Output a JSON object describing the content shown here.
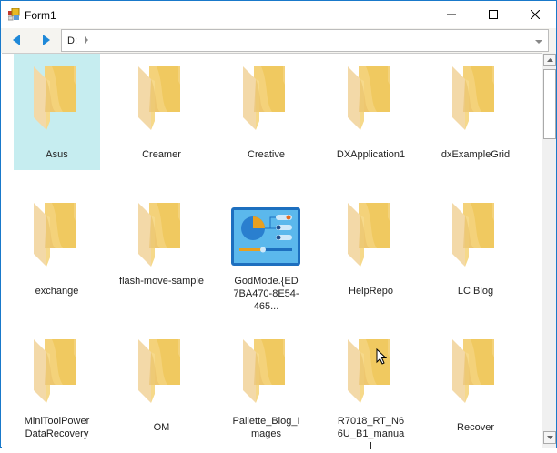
{
  "window": {
    "title": "Form1",
    "minimize": "—",
    "maximize": "☐",
    "close": "✕"
  },
  "toolbar": {
    "back": "back",
    "forward": "forward",
    "drive": "D:"
  },
  "items": [
    {
      "label": "Asus",
      "type": "folder",
      "selected": true
    },
    {
      "label": "Creamer",
      "type": "folder"
    },
    {
      "label": "Creative",
      "type": "folder"
    },
    {
      "label": "DXApplication1",
      "type": "folder"
    },
    {
      "label": "dxExampleGrid",
      "type": "folder"
    },
    {
      "label": "exchange",
      "type": "folder"
    },
    {
      "label": "flash-move-sample",
      "type": "folder"
    },
    {
      "label": "GodMode.{ED7BA470-8E54-465...",
      "type": "control-panel"
    },
    {
      "label": "HelpRepo",
      "type": "folder"
    },
    {
      "label": "LC Blog",
      "type": "folder"
    },
    {
      "label": "MiniToolPowerDataRecovery",
      "type": "folder"
    },
    {
      "label": "OM",
      "type": "folder"
    },
    {
      "label": "Pallette_Blog_Images",
      "type": "folder"
    },
    {
      "label": "R7018_RT_N66U_B1_manual",
      "type": "folder"
    },
    {
      "label": "Recover",
      "type": "folder"
    }
  ],
  "colors": {
    "accent": "#1979ca",
    "selection": "#c6edf0",
    "folder": "#f5cf6e"
  }
}
